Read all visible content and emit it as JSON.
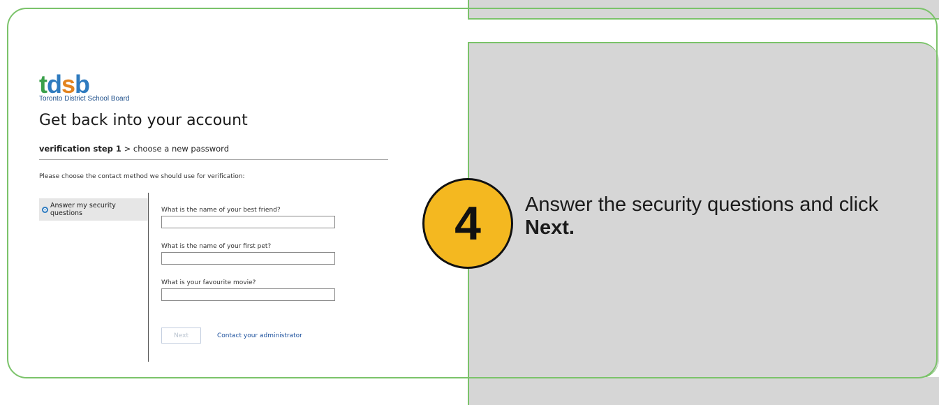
{
  "logo": {
    "letters": [
      "t",
      "d",
      "s",
      "b"
    ],
    "subtitle": "Toronto District School Board"
  },
  "page": {
    "title": "Get back into your account",
    "step_current": "verification step 1",
    "step_separator": ">",
    "step_next": "choose a new password",
    "instruction": "Please choose the contact method we should use for verification:"
  },
  "method": {
    "selected_label": "Answer my security questions"
  },
  "questions": [
    {
      "label": "What is the name of your best friend?",
      "value": ""
    },
    {
      "label": "What is the name of your first pet?",
      "value": ""
    },
    {
      "label": "What is your favourite movie?",
      "value": ""
    }
  ],
  "actions": {
    "next_label": "Next",
    "contact_label": "Contact your administrator"
  },
  "callout": {
    "step_number": "4",
    "text_before": "Answer the security questions and click",
    "text_bold": "Next."
  },
  "colors": {
    "border_green": "#7bc36a",
    "panel_gray": "#d6d6d6",
    "badge_yellow": "#f4b820",
    "link_blue": "#1a4f9c"
  }
}
